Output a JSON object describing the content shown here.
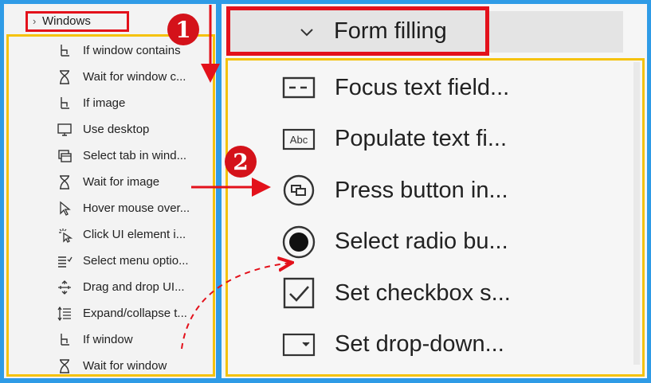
{
  "left_panel": {
    "header": "Windows",
    "items": [
      {
        "label": "If window contains",
        "icon": "if-branch-icon"
      },
      {
        "label": "Wait for window c...",
        "icon": "hourglass-icon"
      },
      {
        "label": "If image",
        "icon": "if-branch-icon"
      },
      {
        "label": "Use desktop",
        "icon": "monitor-icon"
      },
      {
        "label": "Select tab in wind...",
        "icon": "window-tab-icon"
      },
      {
        "label": "Wait for image",
        "icon": "hourglass-icon"
      },
      {
        "label": "Hover mouse over...",
        "icon": "mouse-pointer-icon"
      },
      {
        "label": "Click UI element i...",
        "icon": "click-icon"
      },
      {
        "label": "Select menu optio...",
        "icon": "menu-list-icon"
      },
      {
        "label": "Drag and drop UI...",
        "icon": "drag-drop-icon"
      },
      {
        "label": "Expand/collapse t...",
        "icon": "expand-collapse-icon"
      },
      {
        "label": "If window",
        "icon": "if-branch-icon"
      },
      {
        "label": "Wait for window",
        "icon": "hourglass-icon"
      }
    ]
  },
  "right_panel": {
    "header": "Form filling",
    "items": [
      {
        "label": "Focus text field...",
        "icon": "text-field-icon"
      },
      {
        "label": "Populate text fi...",
        "icon": "abc-field-icon"
      },
      {
        "label": "Press button in...",
        "icon": "press-button-icon"
      },
      {
        "label": "Select radio bu...",
        "icon": "radio-button-icon"
      },
      {
        "label": "Set checkbox s...",
        "icon": "checkbox-icon"
      },
      {
        "label": "Set drop-down...",
        "icon": "dropdown-icon"
      }
    ]
  },
  "annotations": {
    "step1": "1",
    "step2": "2"
  },
  "colors": {
    "frame": "#2f9be6",
    "highlight_red": "#e3111b",
    "highlight_yellow": "#f5c20b"
  }
}
